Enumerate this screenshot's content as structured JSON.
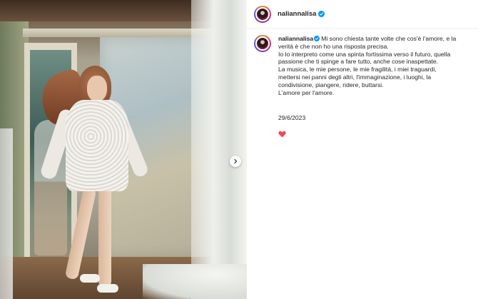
{
  "post": {
    "username": "naliannalisa",
    "caption_lines": [
      "Mi sono chiesta tante volte che cos'è l'amore, e la",
      "verità è che non ho una risposta precisa.",
      "Io lo interpreto come una spinta fortissima verso il futuro, quella",
      "passione che ti spinge a fare tutto, anche cose inaspettate.",
      "La musica, le mie persone, le mie fragilità, i miei traguardi,",
      "mettersi nei panni degli altri, l'immaginazione, i luoghi, la",
      "condivisione, piangere, ridere, buttarsi.",
      "L'amore per l'amore."
    ],
    "date": "29/6/2023",
    "reaction_icon": "heart-icon",
    "verified_icon": "verified-badge-icon"
  },
  "colors": {
    "verified": "#0095f6",
    "heart": "#ed4956",
    "text": "#262626"
  }
}
